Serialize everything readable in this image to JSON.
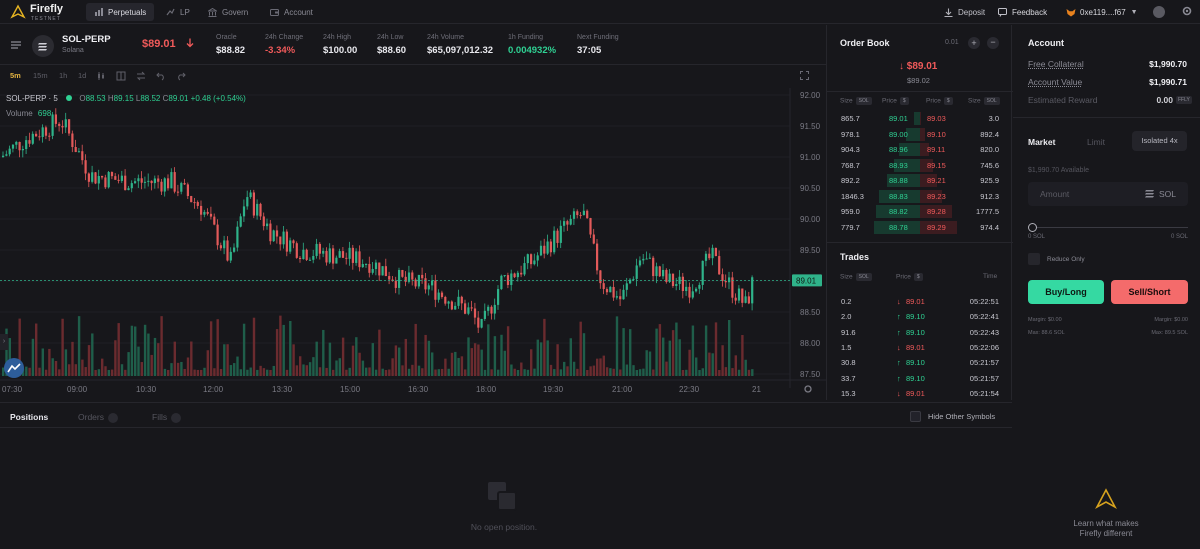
{
  "brand": {
    "name": "Firefly",
    "sub": "TESTNET"
  },
  "nav": {
    "items": [
      {
        "label": "Perpetuals",
        "icon": "perpetuals-icon",
        "active": true
      },
      {
        "label": "LP",
        "icon": "lp-icon",
        "active": false
      },
      {
        "label": "Govern",
        "icon": "govern-icon",
        "active": false
      },
      {
        "label": "Account",
        "icon": "account-icon",
        "active": false
      }
    ],
    "deposit": "Deposit",
    "feedback": "Feedback",
    "wallet": "0xe119....f67"
  },
  "market": {
    "symbol": "SOL-PERP",
    "name": "Solana",
    "price": "$89.01",
    "stats": [
      {
        "label": "Oracle",
        "value": "$88.82",
        "color": "white"
      },
      {
        "label": "24h Change",
        "value": "-3.34%",
        "color": "red"
      },
      {
        "label": "24h High",
        "value": "$100.00",
        "color": "white"
      },
      {
        "label": "24h Low",
        "value": "$88.60",
        "color": "white"
      },
      {
        "label": "24h Volume",
        "value": "$65,097,012.32",
        "color": "white"
      },
      {
        "label": "1h Funding",
        "value": "0.004932%",
        "color": "green"
      },
      {
        "label": "Next Funding",
        "value": "37:05",
        "color": "white"
      }
    ]
  },
  "toolbar": {
    "intervals": [
      "5m",
      "15m",
      "1h",
      "1d"
    ],
    "active": "5m"
  },
  "chart": {
    "legend_symbol": "SOL-PERP · 5",
    "ohlc": {
      "o": "88.53",
      "h": "89.15",
      "l": "88.52",
      "c": "89.01",
      "chg": "+0.48 (+0.54%)"
    },
    "volume_label": "Volume",
    "volume_value": "698",
    "price_labels": [
      "92.00",
      "91.50",
      "91.00",
      "90.50",
      "90.00",
      "89.50",
      "89.00",
      "88.50",
      "88.00",
      "87.50"
    ],
    "last_price_tag": "89.01",
    "time_labels": [
      "07:30",
      "09:00",
      "10:30",
      "12:00",
      "13:30",
      "15:00",
      "16:30",
      "18:00",
      "19:30",
      "21:00",
      "22:30",
      "21"
    ]
  },
  "positions": {
    "tabs": [
      "Positions",
      "Orders",
      "Fills"
    ],
    "hide_other": "Hide Other Symbols",
    "empty": "No open position."
  },
  "orderbook": {
    "title": "Order Book",
    "tick": "0.01",
    "mid_price": "$89.01",
    "mid_sub": "$89.02",
    "headers": {
      "size": "Size",
      "price": "Price",
      "sol": "SOL",
      "usd": "$"
    },
    "rows": [
      {
        "bid_size": "865.7",
        "bid": "89.01",
        "ask": "89.03",
        "ask_size": "3.0",
        "bid_depth": 0.14,
        "ask_depth": 0.03
      },
      {
        "bid_size": "978.1",
        "bid": "89.00",
        "ask": "89.10",
        "ask_size": "892.4",
        "bid_depth": 0.3,
        "ask_depth": 0.11
      },
      {
        "bid_size": "904.3",
        "bid": "88.96",
        "ask": "89.11",
        "ask_size": "820.0",
        "bid_depth": 0.45,
        "ask_depth": 0.2
      },
      {
        "bid_size": "768.7",
        "bid": "88.93",
        "ask": "89.15",
        "ask_size": "745.6",
        "bid_depth": 0.57,
        "ask_depth": 0.28
      },
      {
        "bid_size": "892.2",
        "bid": "88.88",
        "ask": "89.21",
        "ask_size": "925.9",
        "bid_depth": 0.71,
        "ask_depth": 0.38
      },
      {
        "bid_size": "1846.3",
        "bid": "88.83",
        "ask": "89.23",
        "ask_size": "912.3",
        "bid_depth": 0.9,
        "ask_depth": 0.48
      },
      {
        "bid_size": "959.0",
        "bid": "88.82",
        "ask": "89.28",
        "ask_size": "1777.5",
        "bid_depth": 0.95,
        "ask_depth": 0.7
      },
      {
        "bid_size": "779.7",
        "bid": "88.78",
        "ask": "89.29",
        "ask_size": "974.4",
        "bid_depth": 1.0,
        "ask_depth": 0.81
      }
    ]
  },
  "trades": {
    "title": "Trades",
    "headers": {
      "size": "Size",
      "sol": "SOL",
      "price": "Price",
      "usd": "$",
      "time": "Time"
    },
    "rows": [
      {
        "size": "0.2",
        "price": "89.01",
        "side": "down",
        "time": "05:22:51"
      },
      {
        "size": "2.0",
        "price": "89.10",
        "side": "up",
        "time": "05:22:41"
      },
      {
        "size": "91.6",
        "price": "89.10",
        "side": "up",
        "time": "05:22:43"
      },
      {
        "size": "1.5",
        "price": "89.01",
        "side": "down",
        "time": "05:22:06"
      },
      {
        "size": "30.8",
        "price": "89.10",
        "side": "up",
        "time": "05:21:57"
      },
      {
        "size": "33.7",
        "price": "89.10",
        "side": "up",
        "time": "05:21:57"
      },
      {
        "size": "15.3",
        "price": "89.01",
        "side": "down",
        "time": "05:21:54"
      }
    ]
  },
  "account": {
    "title": "Account",
    "rows": [
      {
        "label": "Free Collateral",
        "value": "$1,990.70"
      },
      {
        "label": "Account Value",
        "value": "$1,990.71"
      },
      {
        "label": "Estimated Reward",
        "value": "0.00",
        "unit": "FFLY"
      }
    ],
    "order_tabs": [
      "Market",
      "Limit"
    ],
    "margin_mode": "Isolated 4x",
    "available": "$1,990.70 Available",
    "amount_placeholder": "Amount",
    "amount_unit": "SOL",
    "slider_min": "0 SOL",
    "slider_max": "0 SOL",
    "slider_value": 0,
    "reduce_only": "Reduce Only",
    "buy": "Buy/Long",
    "sell": "Sell/Short",
    "margin_left": "Margin: $0.00",
    "margin_right": "Margin: $0.00",
    "max_left": "Max: 88.6 SOL",
    "max_right": "Max: 89.5 SOL",
    "promo_line1": "Learn what makes",
    "promo_line2": "Firefly different"
  },
  "colors": {
    "green": "#2fd193",
    "red": "#f05a5a",
    "buy": "#35d9a2",
    "sell": "#f46b6b"
  }
}
